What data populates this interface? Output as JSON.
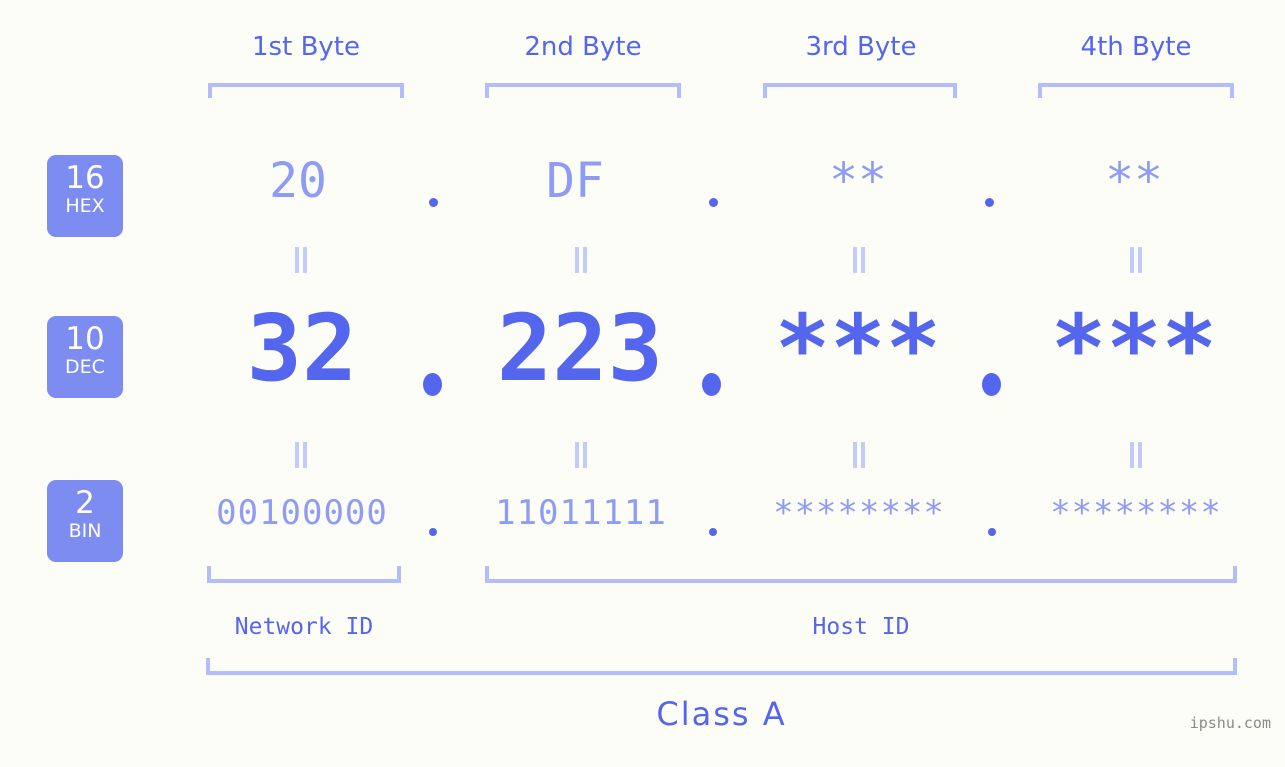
{
  "background_color": "#fdfdf8",
  "accent_color": "#5566ee",
  "accent_light_color": "#8e9cf5",
  "bracket_color": "#b3bdfb",
  "badge_color": "#7c8cf0",
  "byte_headers": [
    {
      "label": "1st Byte"
    },
    {
      "label": "2nd Byte"
    },
    {
      "label": "3rd Byte"
    },
    {
      "label": "4th Byte"
    }
  ],
  "rows": {
    "hex": {
      "badge_number": "16",
      "badge_name": "HEX",
      "values": [
        "20",
        "DF",
        "**",
        "**"
      ],
      "separator": "."
    },
    "dec": {
      "badge_number": "10",
      "badge_name": "DEC",
      "values": [
        "32",
        "223",
        "***",
        "***"
      ],
      "separator": "."
    },
    "bin": {
      "badge_number": "2",
      "badge_name": "BIN",
      "values": [
        "00100000",
        "11011111",
        "********",
        "********"
      ],
      "separator": "."
    }
  },
  "id_labels": {
    "network": "Network ID",
    "host": "Host ID"
  },
  "class_label": "Class A",
  "watermark": "ipshu.com"
}
